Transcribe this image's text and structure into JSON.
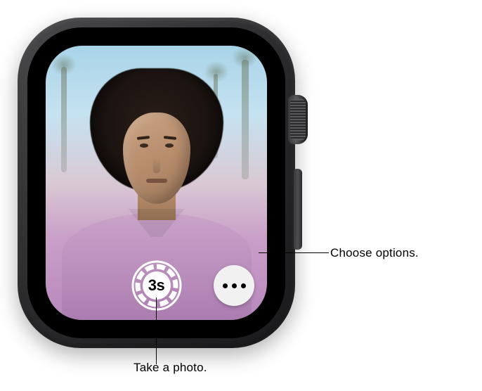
{
  "buttons": {
    "shutter": {
      "timer_label": "3s"
    },
    "more_options": {
      "icon": "ellipsis-icon"
    }
  },
  "callouts": {
    "options": "Choose options.",
    "shutter": "Take a photo."
  }
}
